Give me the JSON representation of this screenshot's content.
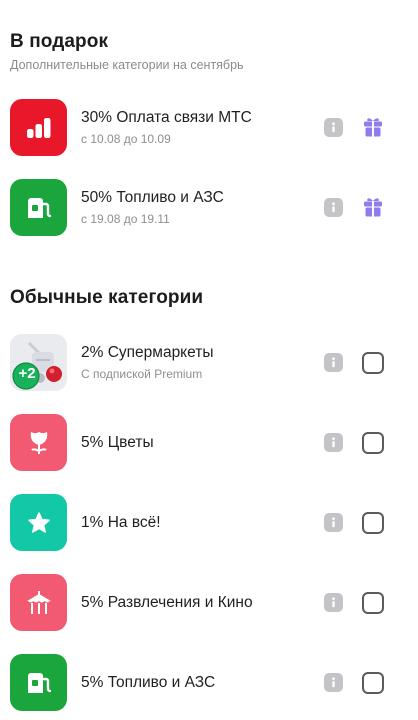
{
  "gift_section": {
    "title": "В подарок",
    "subtitle": "Дополнительные категории на сентябрь",
    "items": [
      {
        "label": "30% Оплата связи МТС",
        "sub": "с 10.08 до 10.09",
        "icon": "mts-bars-icon",
        "color": "#e8172a"
      },
      {
        "label": "50% Топливо и АЗС",
        "sub": "с 19.08 до 19.11",
        "icon": "fuel-pump-icon",
        "color": "#1aa53d"
      }
    ]
  },
  "regular_section": {
    "title": "Обычные категории",
    "items": [
      {
        "label": "2% Супермаркеты",
        "sub": "С подпиской Premium",
        "icon": "supermarket-premium-icon",
        "badge": "+2"
      },
      {
        "label": "5% Цветы",
        "icon": "flower-icon",
        "color": "#f25a72"
      },
      {
        "label": "1% На всё!",
        "icon": "star-icon",
        "color": "#12c8a6"
      },
      {
        "label": "5% Развлечения и Кино",
        "icon": "carousel-icon",
        "color": "#f25a72"
      },
      {
        "label": "5% Топливо и АЗС",
        "icon": "fuel-pump-icon",
        "color": "#1aa53d"
      }
    ]
  },
  "colors": {
    "gift_accent": "#8f7df0",
    "info_grey": "#c4c4c8"
  }
}
